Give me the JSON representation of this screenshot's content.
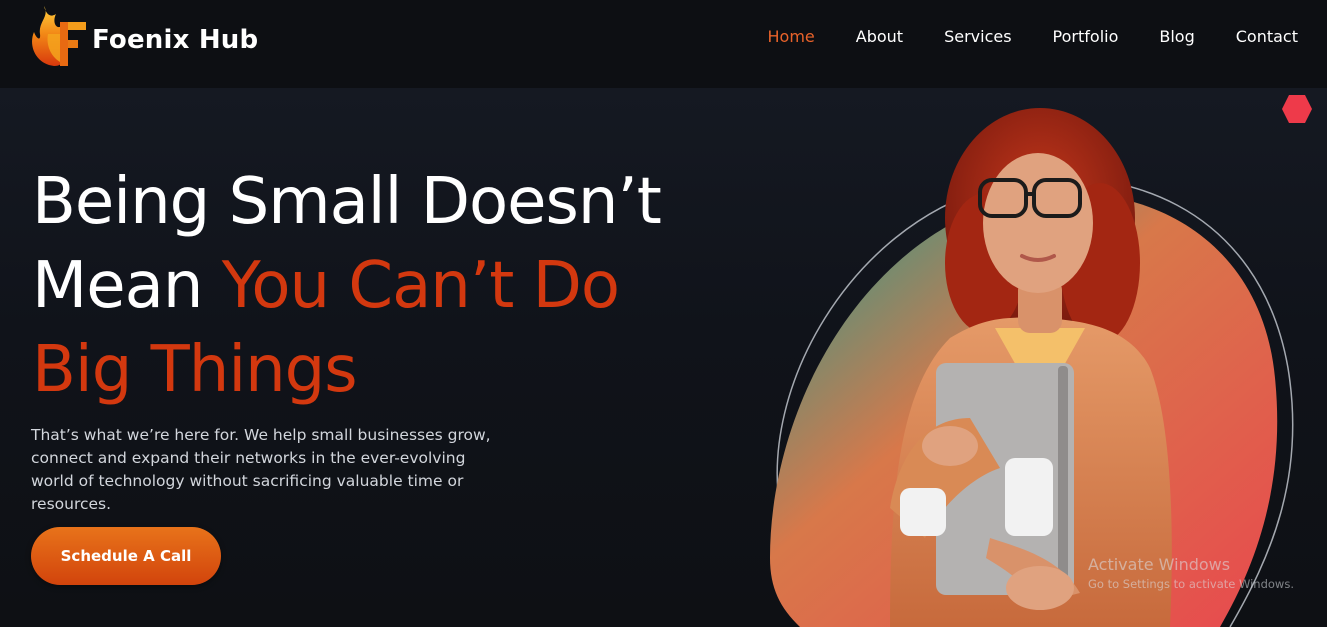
{
  "brand": {
    "name": "Foenix Hub",
    "logo_icon": "flame-f-logo",
    "colors": {
      "flame_start": "#f7a21b",
      "flame_end": "#d8380c"
    }
  },
  "nav": {
    "items": [
      {
        "label": "Home",
        "active": true
      },
      {
        "label": "About",
        "active": false
      },
      {
        "label": "Services",
        "active": false
      },
      {
        "label": "Portfolio",
        "active": false
      },
      {
        "label": "Blog",
        "active": false
      },
      {
        "label": "Contact",
        "active": false
      }
    ],
    "active_color": "#e8622a"
  },
  "hero": {
    "headline": {
      "line1": "Being Small Doesn’t",
      "line2_white": "Mean",
      "line2_accent": "You Can’t Do",
      "line3_accent": "Big Things"
    },
    "description": "That’s what we’re here for. We help small businesses grow, connect and expand their networks in the ever-evolving world of technology without sacrificing valuable time or resources.",
    "cta_label": "Schedule A Call",
    "accent_color": "#d3380f",
    "image_icon": "woman-holding-laptop-illustration",
    "decor_icon": "red-hexagon-icon"
  },
  "watermark": {
    "title": "Activate Windows",
    "subtitle": "Go to Settings to activate Windows."
  }
}
